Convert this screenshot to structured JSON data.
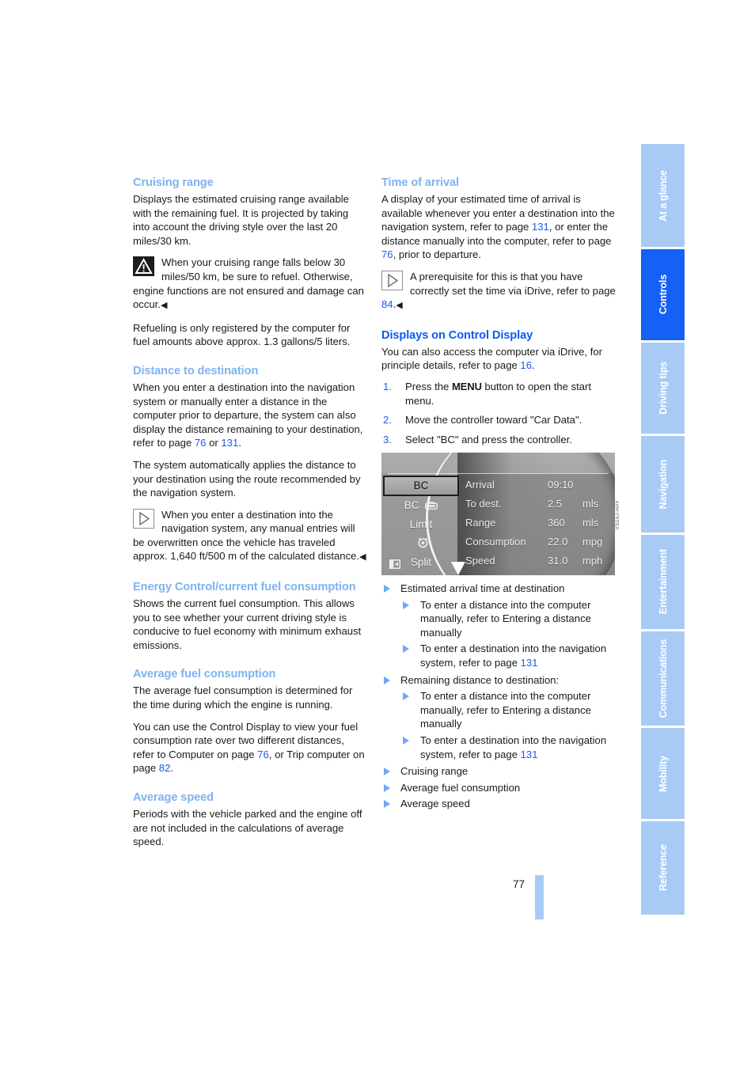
{
  "page": {
    "number": "77",
    "figure_caption": "VS1ILI-HAY"
  },
  "left_column": {
    "sections": [
      {
        "heading": "Cruising range",
        "paragraphs": [
          "Displays the estimated cruising range available with the remaining fuel. It is projected by taking into account the driving style over the last 20 miles/30 km."
        ],
        "warning_note": "When your cruising range falls below 30 miles/50 km, be sure to refuel. Otherwise, engine functions are not ensured and damage can occur.",
        "closing_paragraph": "Refueling is only registered by the computer for fuel amounts above approx. 1.3 gallons/5 liters."
      },
      {
        "heading": "Distance to destination",
        "para_1_a": "When you enter a destination into the navigation system or manually enter a distance in the computer prior to departure, the system can also display the distance remaining to your destination, refer to page ",
        "ref_76": "76",
        "para_1_b": " or ",
        "ref_131": "131",
        "para_1_c": ".",
        "para_2": "The system automatically applies the distance to your destination using the route recommended by the navigation system.",
        "note": "When you enter a destination into the navigation system, any manual entries will be overwritten once the vehicle has traveled approx. 1,640 ft/500 m of the calculated distance."
      },
      {
        "heading": "Energy Control/current fuel consumption",
        "paragraphs": [
          "Shows the current fuel consumption. This allows you to see whether your current driving style is conducive to fuel economy with minimum exhaust emissions."
        ]
      },
      {
        "heading": "Average fuel consumption",
        "para_1": "The average fuel consumption is determined for the time during which the engine is running.",
        "para_2_a": "You can use the Control Display to view your fuel consumption rate over two different distances, refer to Computer on page ",
        "ref_76": "76",
        "para_2_b": ", or Trip computer on page ",
        "ref_82": "82",
        "para_2_c": "."
      },
      {
        "heading": "Average speed",
        "paragraphs": [
          "Periods with the vehicle parked and the engine off are not included in the calculations of average speed."
        ]
      }
    ]
  },
  "right_column": {
    "time_of_arrival": {
      "heading": "Time of arrival",
      "para_a": "A display of your estimated time of arrival is available whenever you enter a destination into the navigation system, refer to page ",
      "ref_131": "131",
      "para_b": ", or enter the distance manually into the computer, refer to page ",
      "ref_76": "76",
      "para_c": ", prior to departure.",
      "note_a": "A prerequisite for this is that you have correctly set the time via iDrive, refer to page ",
      "note_ref_84": "84",
      "note_b": "."
    },
    "displays": {
      "heading": "Displays on Control Display",
      "intro_a": "You can also access the computer via iDrive, for principle details, refer to page ",
      "intro_ref_16": "16",
      "intro_b": ".",
      "steps": [
        {
          "num": "1.",
          "text_a": "Press the ",
          "bold": "MENU",
          "text_b": " button to open the start menu."
        },
        {
          "num": "2.",
          "text_a": "Move the controller toward \"Car Data\".",
          "bold": "",
          "text_b": ""
        },
        {
          "num": "3.",
          "text_a": "Select \"BC\" and press the controller.",
          "bold": "",
          "text_b": ""
        }
      ]
    },
    "legend": {
      "item_1": "Estimated arrival time at destination",
      "item_1_subs": [
        {
          "text": "To enter a distance into the computer manually, refer to Entering a distance manually",
          "ref": ""
        },
        {
          "text": "To enter a destination into the navigation system, refer to page ",
          "ref": "131"
        }
      ],
      "item_2": "Remaining distance to destination:",
      "item_2_subs": [
        {
          "text": "To enter a distance into the computer manually, refer to Entering a distance manually",
          "ref": ""
        },
        {
          "text": "To enter a destination into the navigation system, refer to page ",
          "ref": "131"
        }
      ],
      "item_3": "Cruising range",
      "item_4": "Average fuel consumption",
      "item_5": "Average speed"
    }
  },
  "control_display": {
    "menu_items": [
      {
        "label": "BC",
        "icon": "",
        "selected": true
      },
      {
        "label": "BC",
        "icon": "car-icon",
        "selected": false
      },
      {
        "label": "Limit",
        "icon": "",
        "selected": false
      },
      {
        "label": "",
        "icon": "alarm-clock-icon",
        "selected": false
      },
      {
        "label": "Split",
        "icon": "split-icon",
        "selected": false
      },
      {
        "label": "",
        "icon": "oil-can-icon",
        "selected": false
      }
    ],
    "rows": [
      {
        "label": "Arrival",
        "value": "09:10",
        "unit": ""
      },
      {
        "label": "To dest.",
        "value": "2.5",
        "unit": "mls"
      },
      {
        "label": "Range",
        "value": "360",
        "unit": "mls"
      },
      {
        "label": "Consumption",
        "value": "22.0",
        "unit": "mpg"
      },
      {
        "label": "Speed",
        "value": "31.0",
        "unit": "mph"
      }
    ]
  },
  "side_tabs": [
    {
      "label": "At a glance",
      "active": false
    },
    {
      "label": "Controls",
      "active": true
    },
    {
      "label": "Driving tips",
      "active": false
    },
    {
      "label": "Navigation",
      "active": false
    },
    {
      "label": "Entertainment",
      "active": false
    },
    {
      "label": "Communications",
      "active": false
    },
    {
      "label": "Mobility",
      "active": false
    },
    {
      "label": "Reference",
      "active": false
    }
  ],
  "colors": {
    "subheading": "#7fb2f0",
    "strong_heading": "#0a5cf5",
    "link": "#1a5cf0",
    "tab_inactive": "#a8cbf5",
    "tab_active": "#1560f5"
  }
}
